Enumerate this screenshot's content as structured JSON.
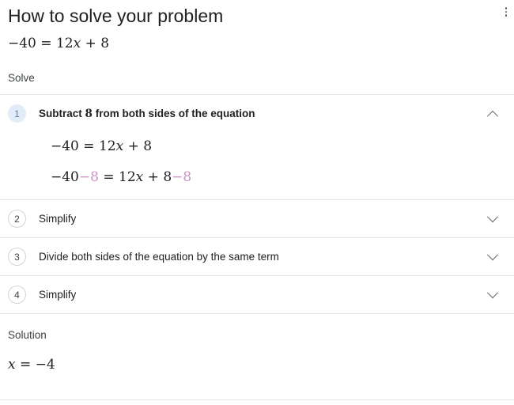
{
  "header": {
    "title": "How to solve your problem",
    "menu_icon": "more-vert-icon"
  },
  "problem": {
    "equation_lhs": "−40",
    "equation_eq": "=",
    "equation_rhs_coeff": "12",
    "equation_rhs_var": "x",
    "equation_rhs_plus": "+",
    "equation_rhs_const": "8",
    "equation_plain": "−40 = 12x + 8"
  },
  "solve_section": {
    "label": "Solve"
  },
  "steps": [
    {
      "number": "1",
      "title": "Subtract 8 from both sides of the equation",
      "title_prefix": "Subtract",
      "title_number": "8",
      "title_suffix": "from both sides of the equation",
      "expanded": true,
      "chevron_icon": "chevron-up-icon",
      "lines": [
        {
          "plain": "−40 = 12x + 8",
          "left_base": "−40",
          "left_hl": "",
          "eq": "=",
          "right_base": "12",
          "right_var": "x",
          "right_plus": "+",
          "right_const": "8",
          "right_hl": ""
        },
        {
          "plain": "−40−8 = 12x + 8−8",
          "left_base": "−40",
          "left_hl": "−8",
          "eq": "=",
          "right_base": "12",
          "right_var": "x",
          "right_plus": "+",
          "right_const": "8",
          "right_hl": "−8"
        }
      ]
    },
    {
      "number": "2",
      "title": "Simplify",
      "expanded": false,
      "chevron_icon": "chevron-down-icon"
    },
    {
      "number": "3",
      "title": "Divide both sides of the equation by the same term",
      "expanded": false,
      "chevron_icon": "chevron-down-icon"
    },
    {
      "number": "4",
      "title": "Simplify",
      "expanded": false,
      "chevron_icon": "chevron-down-icon"
    }
  ],
  "solution": {
    "label": "Solution",
    "value_var": "x",
    "value_eq": "=",
    "value_num": "−4",
    "value_plain": "x = −4"
  },
  "colors": {
    "highlight": "#cf8fc7",
    "badge_active_bg": "#e2ecf9",
    "badge_active_text": "#5a7da8",
    "divider": "#e4e6e8",
    "text": "#202124"
  }
}
